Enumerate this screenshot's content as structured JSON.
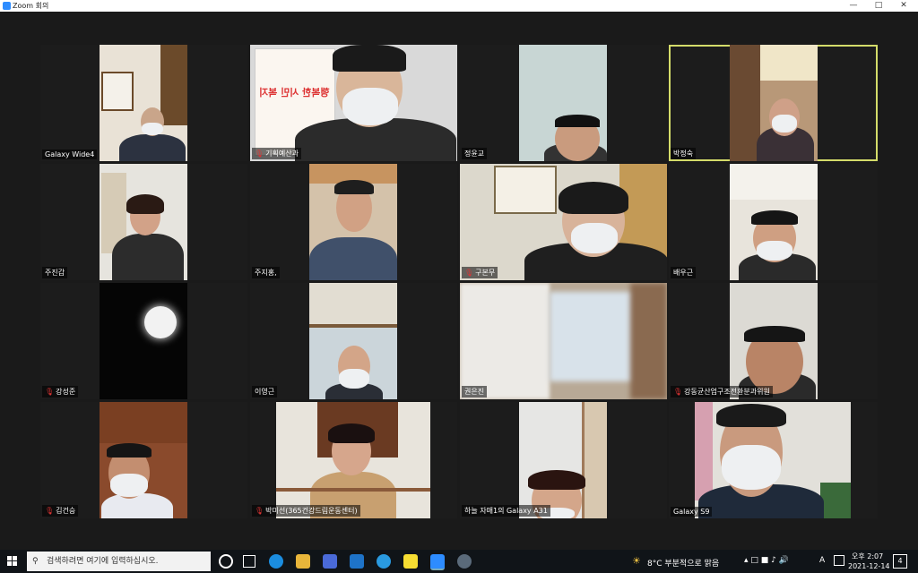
{
  "window": {
    "title": "Zoom 회의",
    "accent": "#2d8cff",
    "active_speaker_color": "#d4dc6a"
  },
  "gallery": {
    "tiles": [
      {
        "name": "Galaxy Wide4",
        "muted": false
      },
      {
        "name": "기획예산과",
        "muted": true
      },
      {
        "name": "정윤교",
        "muted": false
      },
      {
        "name": "박정숙",
        "muted": false,
        "active": true
      },
      {
        "name": "주진갑",
        "muted": false
      },
      {
        "name": "주지홍,",
        "muted": false
      },
      {
        "name": "구본무",
        "muted": true
      },
      {
        "name": "배우근",
        "muted": false
      },
      {
        "name": "강성준",
        "muted": true
      },
      {
        "name": "이영근",
        "muted": false
      },
      {
        "name": "권은진",
        "muted": false
      },
      {
        "name": "강동균산업구조전환분과위원",
        "muted": true
      },
      {
        "name": "김건승",
        "muted": true
      },
      {
        "name": "박미선(365건강드림운동센터)",
        "muted": true
      },
      {
        "name": "하늘 자매1의 Galaxy A31",
        "muted": false
      },
      {
        "name": "Galaxy S9",
        "muted": false
      }
    ],
    "banner_text": "행복한 시민 복지"
  },
  "taskbar": {
    "search_placeholder": "검색하려면 여기에 입력하십시오.",
    "weather": "8°C 부분적으로 맑음",
    "ime": "A",
    "time": "오후 2:07",
    "date": "2021-12-14",
    "notifications": "4",
    "icons": [
      "windows-start-icon",
      "cortana-icon",
      "task-view-icon",
      "edge-icon",
      "file-explorer-icon",
      "store-icon",
      "mail-icon",
      "ie-icon",
      "kakaotalk-icon",
      "zoom-icon",
      "app-icon"
    ]
  }
}
